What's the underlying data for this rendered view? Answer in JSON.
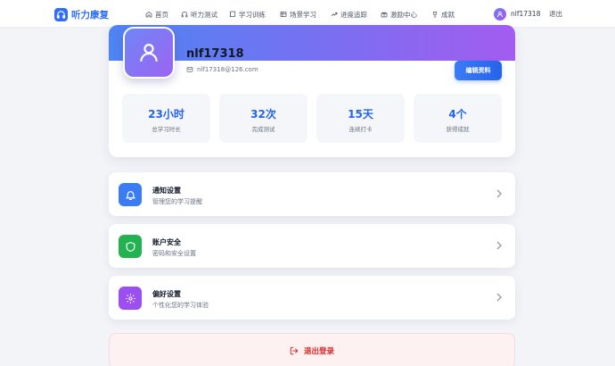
{
  "brand": {
    "name": "听力康复",
    "icon": "headphones-icon"
  },
  "nav": [
    {
      "label": "首页",
      "icon": "home-icon"
    },
    {
      "label": "听力测试",
      "icon": "headphones-icon"
    },
    {
      "label": "学习训练",
      "icon": "book-icon"
    },
    {
      "label": "场景学习",
      "icon": "scene-icon"
    },
    {
      "label": "进度追踪",
      "icon": "trend-icon"
    },
    {
      "label": "激励中心",
      "icon": "gift-icon"
    },
    {
      "label": "成就",
      "icon": "trophy-icon"
    }
  ],
  "user": {
    "name": "nlf17318",
    "logout": "退出"
  },
  "profile": {
    "name": "nlf17318",
    "email": "nlf17318@126.com",
    "edit_label": "编辑资料",
    "stats": [
      {
        "value": "23小时",
        "label": "总学习时长"
      },
      {
        "value": "32次",
        "label": "完成测试"
      },
      {
        "value": "15天",
        "label": "连续打卡"
      },
      {
        "value": "4个",
        "label": "获得成就"
      }
    ]
  },
  "settings": [
    {
      "title": "通知设置",
      "desc": "管理您的学习提醒",
      "icon": "bell-icon",
      "color": "#3b7cf5"
    },
    {
      "title": "账户安全",
      "desc": "密码和安全设置",
      "icon": "shield-icon",
      "color": "#22b350"
    },
    {
      "title": "偏好设置",
      "desc": "个性化您的学习体验",
      "icon": "gear-icon",
      "color": "#9b4ff0"
    }
  ],
  "logout_button": {
    "label": "退出登录",
    "color": "#dc2626"
  },
  "colors": {
    "accent": "#2563eb",
    "banner_start": "#4e84f3",
    "banner_end": "#a35cf0"
  }
}
